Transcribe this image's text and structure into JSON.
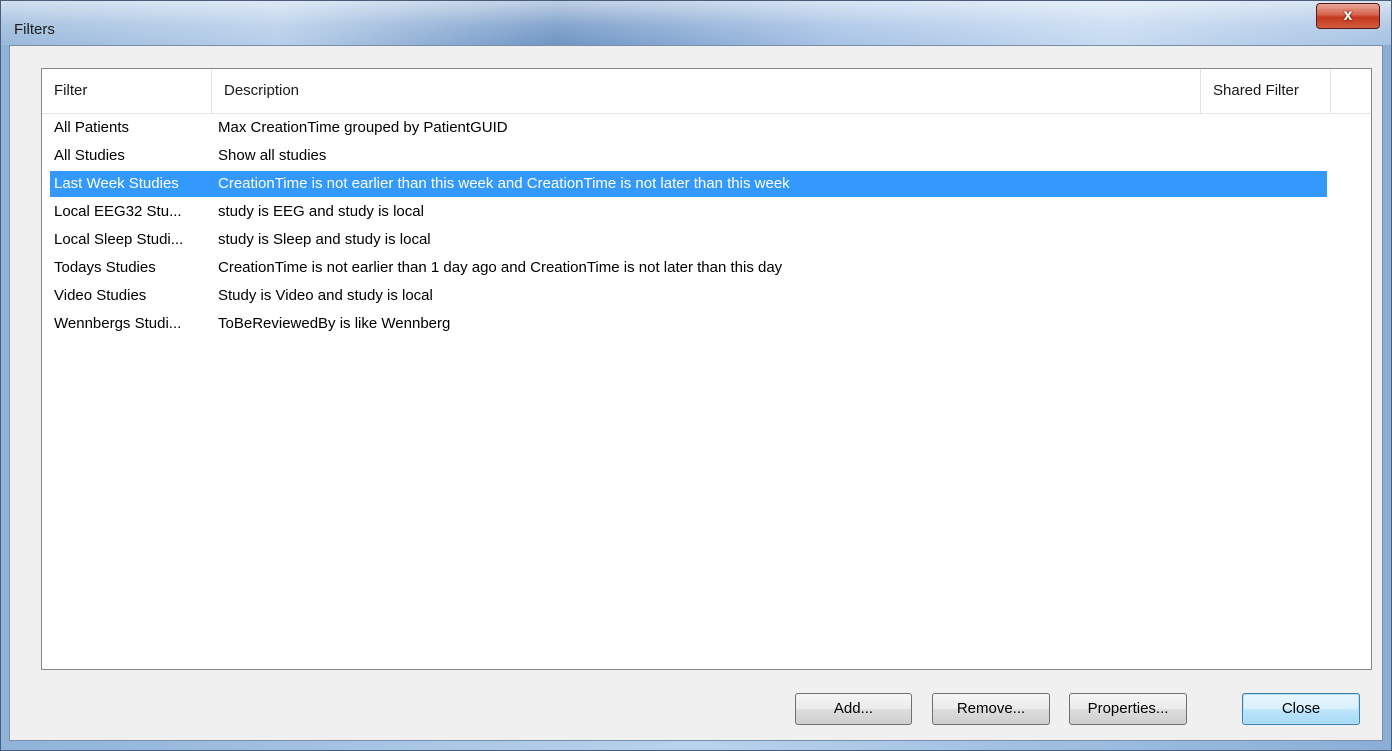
{
  "window": {
    "title": "Filters",
    "close_label": "x"
  },
  "list": {
    "columns": [
      "Filter",
      "Description",
      "Shared Filter"
    ],
    "rows": [
      {
        "filter": "All Patients",
        "description": "Max CreationTime grouped by PatientGUID",
        "shared": "",
        "selected": false
      },
      {
        "filter": "All Studies",
        "description": "Show all studies",
        "shared": "",
        "selected": false
      },
      {
        "filter": "Last Week Studies",
        "description": "CreationTime is not earlier than this week and CreationTime is not later than this week",
        "shared": "",
        "selected": true
      },
      {
        "filter": "Local EEG32 Stu...",
        "description": "study is EEG and study is local",
        "shared": "",
        "selected": false
      },
      {
        "filter": "Local Sleep Studi...",
        "description": "study is Sleep and study is local",
        "shared": "",
        "selected": false
      },
      {
        "filter": "Todays Studies",
        "description": "CreationTime is not earlier than 1 day ago and CreationTime is not later than this day",
        "shared": "",
        "selected": false
      },
      {
        "filter": "Video Studies",
        "description": "Study is Video and study is local",
        "shared": "",
        "selected": false
      },
      {
        "filter": "Wennbergs Studi...",
        "description": "ToBeReviewedBy is like Wennberg",
        "shared": "",
        "selected": false
      }
    ]
  },
  "buttons": {
    "add": "Add...",
    "remove": "Remove...",
    "properties": "Properties...",
    "close": "Close"
  },
  "colors": {
    "selection": "#3399ff",
    "close_button": "#c7432a"
  }
}
